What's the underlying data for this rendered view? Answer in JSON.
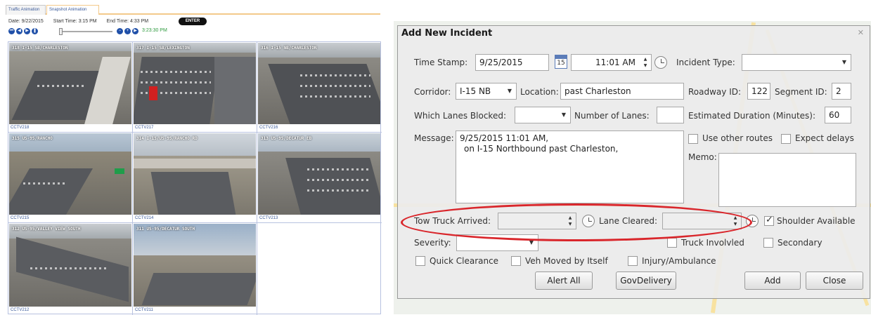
{
  "left_panel": {
    "tabs": [
      "Traffic Animation",
      "Snapshot Animation"
    ],
    "date_label": "Date: 9/22/2015",
    "start_time_label": "Start Time: 3:15 PM",
    "end_time_label": "End Time: 4:33 PM",
    "enter_label": "ENTER",
    "current_time": "3:23:30 PM",
    "cameras": [
      {
        "caption": "CCTV218",
        "overlay": "318 I-15 SB/CHARLESTON"
      },
      {
        "caption": "CCTV217",
        "overlay": "317 I-15 SB/LEXINGTON"
      },
      {
        "caption": "CCTV216",
        "overlay": "316 I-15 NB/CHARLESTON"
      },
      {
        "caption": "CCTV215",
        "overlay": "315 US-95/RANCHO"
      },
      {
        "caption": "CCTV214",
        "overlay": "314 I-15/US-95/RANCHO RD"
      },
      {
        "caption": "CCTV213",
        "overlay": "313 US-95/DECATUR EB"
      },
      {
        "caption": "CCTV212",
        "overlay": "312 US-95/VALLEY VIEW SOUTH"
      },
      {
        "caption": "CCTV211",
        "overlay": "311 US-95/DECATUR SOUTH"
      }
    ]
  },
  "dialog": {
    "title": "Add New Incident",
    "close_glyph": "✕",
    "time_stamp_label": "Time Stamp:",
    "time_stamp_date": "9/25/2015",
    "calendar_day": "15",
    "time_stamp_time": "11:01 AM",
    "incident_type_label": "Incident Type:",
    "incident_type_value": "",
    "corridor_label": "Corridor:",
    "corridor_value": "I-15 NB",
    "location_label": "Location:",
    "location_value": "past Charleston",
    "roadway_id_label": "Roadway ID:",
    "roadway_id_value": "122",
    "segment_id_label": "Segment ID:",
    "segment_id_value": "2",
    "lanes_blocked_label": "Which Lanes Blocked:",
    "lanes_blocked_value": "",
    "number_of_lanes_label": "Number of Lanes:",
    "number_of_lanes_value": "",
    "estimated_duration_label": "Estimated Duration (Minutes):",
    "estimated_duration_value": "60",
    "message_label": "Message:",
    "message_line1": "9/25/2015 11:01 AM,",
    "message_line2": "on I-15 Northbound past Charleston,",
    "use_other_routes_label": "Use other routes",
    "expect_delays_label": "Expect delays",
    "memo_label": "Memo:",
    "tow_truck_arrived_label": "Tow Truck Arrived:",
    "lane_cleared_label": "Lane Cleared:",
    "shoulder_available_label": "Shoulder Available",
    "severity_label": "Severity:",
    "truck_involved_label": "Truck Involvled",
    "secondary_label": "Secondary",
    "quick_clearance_label": "Quick Clearance",
    "veh_moved_label": "Veh Moved by Itself",
    "injury_label": "Injury/Ambulance",
    "alert_all_label": "Alert All",
    "govdelivery_label": "GovDelivery",
    "add_label": "Add",
    "close_label": "Close"
  },
  "colors": {
    "highlight_ellipse": "#d9262b",
    "link_blue": "#3a5a9a",
    "time_green": "#2e9a3e"
  }
}
